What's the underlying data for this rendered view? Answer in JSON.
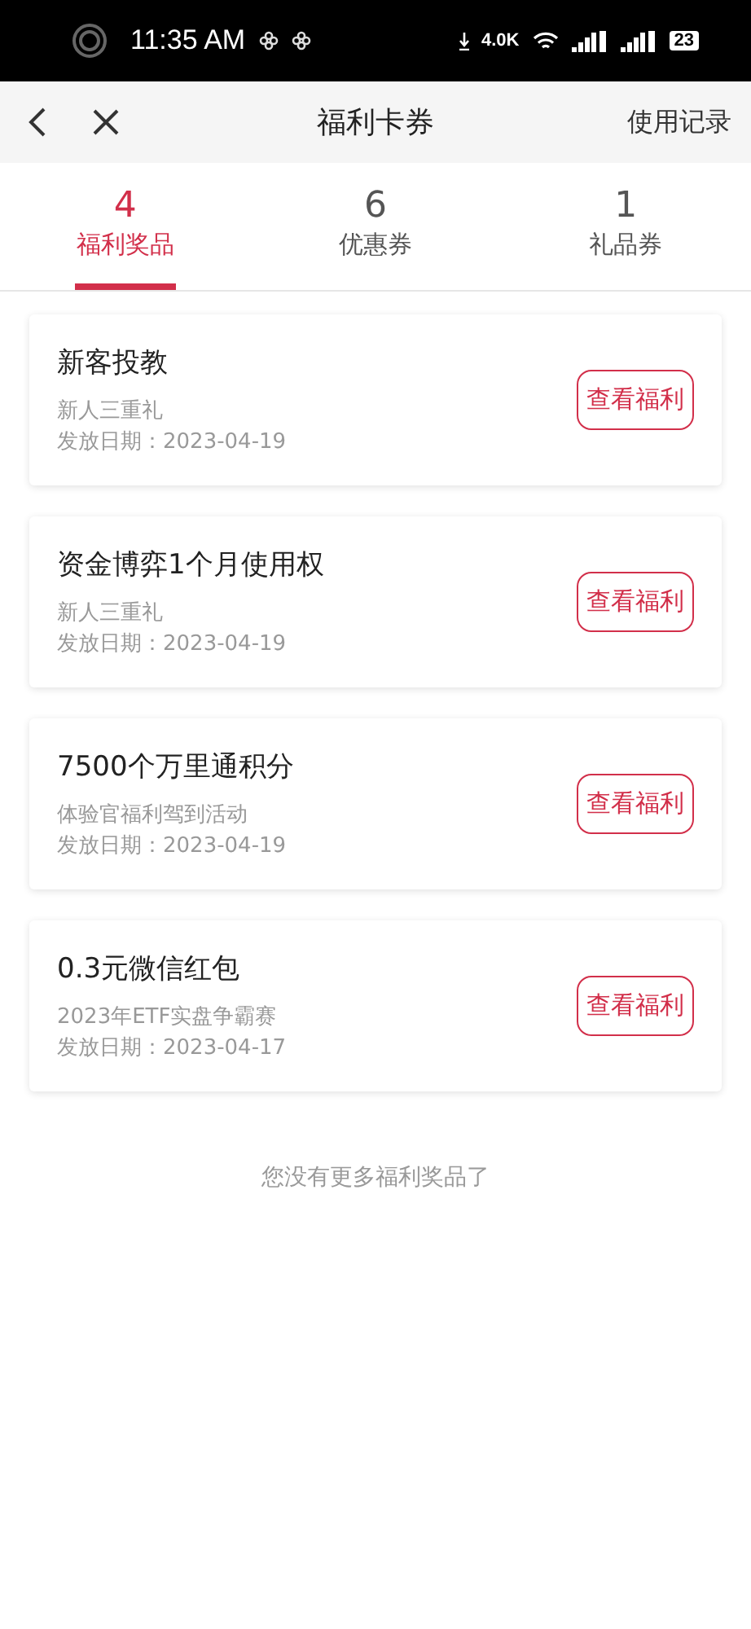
{
  "status_bar": {
    "time": "11:35 AM",
    "net_speed": "4.0K",
    "battery": "23"
  },
  "nav": {
    "title": "福利卡券",
    "action": "使用记录"
  },
  "tabs": [
    {
      "count": "4",
      "label": "福利奖品",
      "selected": true
    },
    {
      "count": "6",
      "label": "优惠券",
      "selected": false
    },
    {
      "count": "1",
      "label": "礼品券",
      "selected": false
    }
  ],
  "cards": [
    {
      "title": "新客投教",
      "source": "新人三重礼",
      "date": "发放日期：2023-04-19",
      "button": "查看福利"
    },
    {
      "title": "资金博弈1个月使用权",
      "source": "新人三重礼",
      "date": "发放日期：2023-04-19",
      "button": "查看福利"
    },
    {
      "title": "7500个万里通积分",
      "source": "体验官福利驾到活动",
      "date": "发放日期：2023-04-19",
      "button": "查看福利"
    },
    {
      "title": "0.3元微信红包",
      "source": "2023年ETF实盘争霸赛",
      "date": "发放日期：2023-04-17",
      "button": "查看福利"
    }
  ],
  "footer": "您没有更多福利奖品了"
}
